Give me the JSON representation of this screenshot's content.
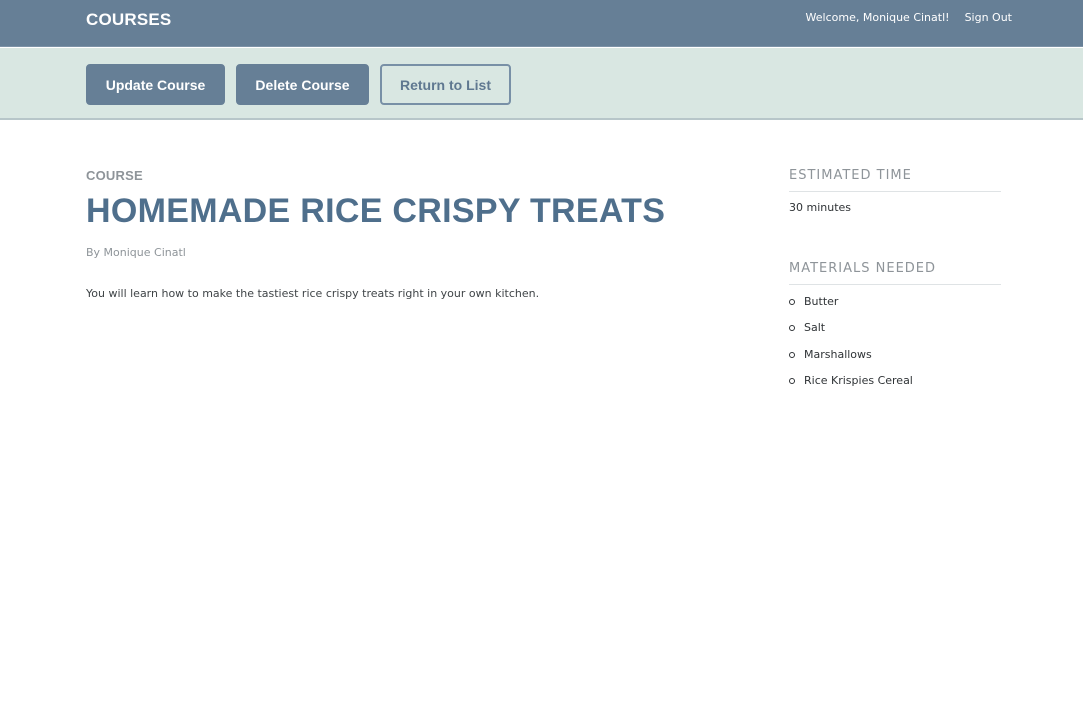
{
  "header": {
    "logo": "COURSES",
    "welcome": "Welcome, Monique Cinatl!",
    "sign_out": "Sign Out"
  },
  "actions": {
    "update": "Update Course",
    "delete": "Delete Course",
    "return": "Return to List"
  },
  "course": {
    "label": "COURSE",
    "title": "HOMEMADE RICE CRISPY TREATS",
    "author": "By Monique Cinatl",
    "description": "You will learn how to make the tastiest rice crispy treats right in your own kitchen."
  },
  "sidebar": {
    "time_heading": "ESTIMATED TIME",
    "time_value": "30 minutes",
    "materials_heading": "MATERIALS NEEDED",
    "materials": [
      "Butter",
      "Salt",
      "Marshallows",
      "Rice Krispies Cereal"
    ]
  },
  "colors": {
    "header_bg": "#667f96",
    "actions_bg": "#d9e7e2",
    "title": "#4f6f8c"
  }
}
